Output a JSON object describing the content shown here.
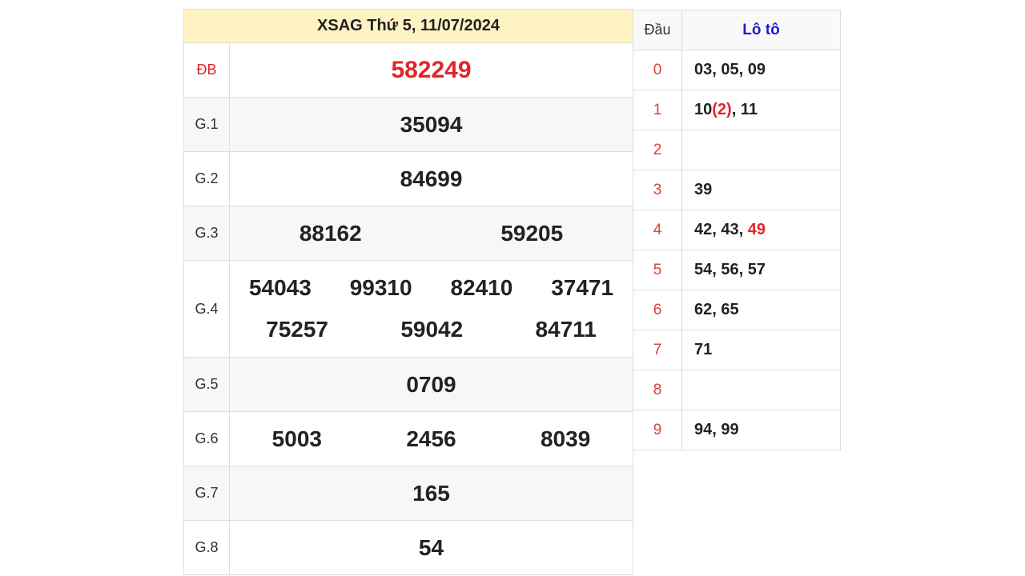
{
  "title": "XSAG Thứ 5, 11/07/2024",
  "colors": {
    "special": "#e0262a",
    "header_bg": "#fff3c4",
    "loto_header": "#1c1cc9",
    "head_digit": "#d9443a"
  },
  "prizes": [
    {
      "label": "ĐB",
      "numbers": [
        "582249"
      ],
      "special": true
    },
    {
      "label": "G.1",
      "numbers": [
        "35094"
      ]
    },
    {
      "label": "G.2",
      "numbers": [
        "84699"
      ]
    },
    {
      "label": "G.3",
      "numbers": [
        "88162",
        "59205"
      ]
    },
    {
      "label": "G.4",
      "numbers": [
        "54043",
        "99310",
        "82410",
        "37471",
        "75257",
        "59042",
        "84711"
      ]
    },
    {
      "label": "G.5",
      "numbers": [
        "0709"
      ]
    },
    {
      "label": "G.6",
      "numbers": [
        "5003",
        "2456",
        "8039"
      ]
    },
    {
      "label": "G.7",
      "numbers": [
        "165"
      ]
    },
    {
      "label": "G.8",
      "numbers": [
        "54"
      ]
    }
  ],
  "loto": {
    "header_dau": "Đầu",
    "header_loto": "Lô tô",
    "rows": [
      {
        "head": "0",
        "values": [
          {
            "t": "03, 05, 09"
          }
        ]
      },
      {
        "head": "1",
        "values": [
          {
            "t": "10"
          },
          {
            "t": "(2)",
            "hl": true
          },
          {
            "t": ", 11"
          }
        ]
      },
      {
        "head": "2",
        "values": []
      },
      {
        "head": "3",
        "values": [
          {
            "t": "39"
          }
        ]
      },
      {
        "head": "4",
        "values": [
          {
            "t": "42, 43, "
          },
          {
            "t": "49",
            "hl": true
          }
        ]
      },
      {
        "head": "5",
        "values": [
          {
            "t": "54, 56, 57"
          }
        ]
      },
      {
        "head": "6",
        "values": [
          {
            "t": "62, 65"
          }
        ]
      },
      {
        "head": "7",
        "values": [
          {
            "t": "71"
          }
        ]
      },
      {
        "head": "8",
        "values": []
      },
      {
        "head": "9",
        "values": [
          {
            "t": "94, 99"
          }
        ]
      }
    ]
  }
}
